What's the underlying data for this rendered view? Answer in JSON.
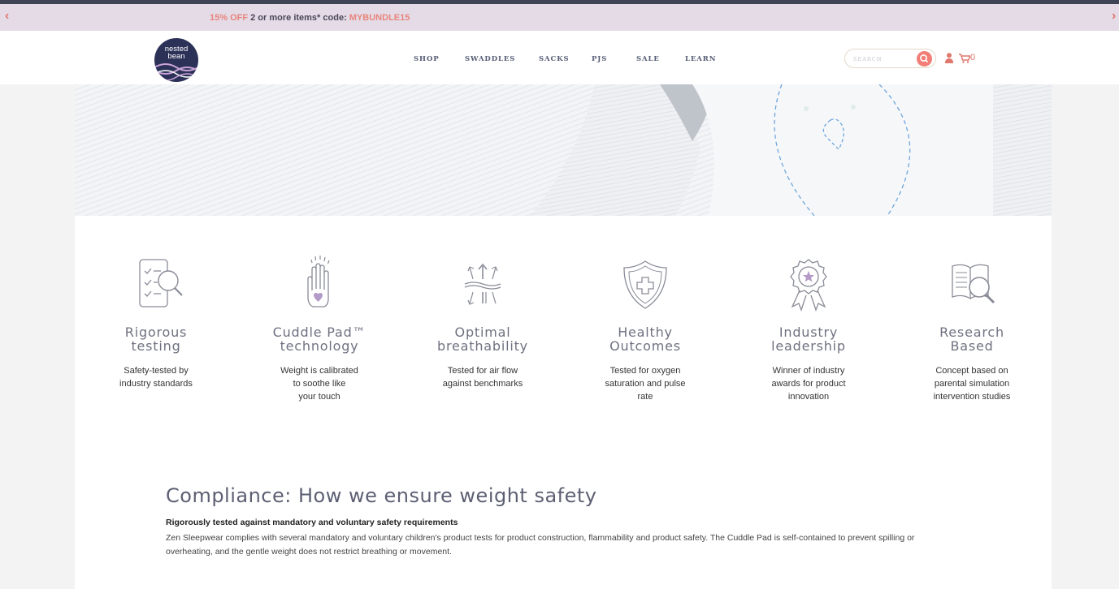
{
  "promo": {
    "highlight": "15% OFF",
    "text": " 2 or more items* code: ",
    "code": "MYBUNDLE15",
    "left_arrow": "‹",
    "right_arrow": "›",
    "accent_color": "#e8857c"
  },
  "header": {
    "logo_line1": "nested",
    "logo_line2": "bean",
    "nav": [
      "SHOP",
      "SWADDLES",
      "SACKS",
      "PJS",
      "SALE",
      "LEARN"
    ],
    "search_placeholder": "SEARCH",
    "cart_count": "0",
    "icons": [
      "search-icon",
      "user-icon",
      "cart-icon"
    ]
  },
  "features": [
    {
      "icon": "checklist-magnifier-icon",
      "title_line1": "Rigorous",
      "title_line2": "testing",
      "desc": [
        "Safety-tested by",
        "industry standards"
      ]
    },
    {
      "icon": "hand-heart-icon",
      "title_line1": "Cuddle Pad™",
      "title_line2": "technology",
      "desc": [
        "Weight is calibrated",
        "to soothe like",
        "your touch"
      ]
    },
    {
      "icon": "airflow-arrows-icon",
      "title_line1": "Optimal",
      "title_line2": "breathability",
      "desc": [
        "Tested for air flow",
        "against benchmarks"
      ]
    },
    {
      "icon": "shield-plus-icon",
      "title_line1": "Healthy",
      "title_line2": "Outcomes",
      "desc": [
        "Tested for oxygen",
        "saturation and pulse",
        "rate"
      ]
    },
    {
      "icon": "award-badge-icon",
      "title_line1": "Industry",
      "title_line2": "leadership",
      "desc": [
        "Winner of industry",
        "awards for product",
        "innovation"
      ]
    },
    {
      "icon": "book-magnifier-icon",
      "title_line1": "Research",
      "title_line2": "Based",
      "desc": [
        "Concept based on",
        "parental simulation",
        "intervention studies"
      ]
    }
  ],
  "compliance": {
    "title": "Compliance: How we ensure weight safety",
    "subtitle": "Rigorously tested against mandatory and voluntary safety requirements",
    "body": "Zen Sleepwear complies with several mandatory and voluntary children's product tests for product construction, flammability and product safety. The Cuddle Pad is self-contained to prevent spilling or overheating, and the gentle weight does not restrict breathing or movement."
  },
  "colors": {
    "navy": "#2c3158",
    "promo_bg": "#e4dbe7",
    "coral": "#f17f77",
    "icon_stroke": "#8a8c98",
    "icon_accent": "#b39ac7"
  }
}
